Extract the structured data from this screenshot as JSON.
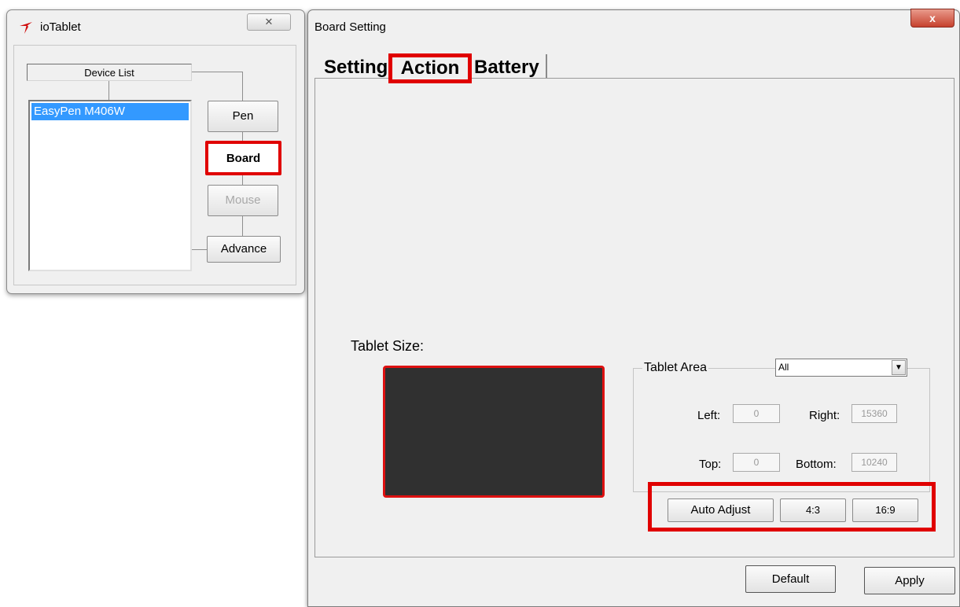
{
  "io_window": {
    "title": "ioTablet",
    "close_glyph": "✕",
    "device_list_label": "Device List",
    "devices": [
      "EasyPen M406W"
    ],
    "buttons": {
      "pen": "Pen",
      "board": "Board",
      "mouse": "Mouse",
      "advance": "Advance"
    }
  },
  "board_window": {
    "title": "Board Setting",
    "close_glyph": "x",
    "tabs": [
      "Setting",
      "Action",
      "Battery"
    ],
    "selected_tab": "Action",
    "tablet_size_label": "Tablet Size:",
    "tablet_area": {
      "label": "Tablet Area",
      "selected": "All",
      "left_label": "Left:",
      "left_value": "0",
      "right_label": "Right:",
      "right_value": "15360",
      "top_label": "Top:",
      "top_value": "0",
      "bottom_label": "Bottom:",
      "bottom_value": "10240"
    },
    "buttons": {
      "auto_adjust": "Auto Adjust",
      "ratio_4_3": "4:3",
      "ratio_16_9": "16:9",
      "default": "Default",
      "apply": "Apply"
    }
  },
  "colors": {
    "highlight": "#e00000",
    "selection": "#3399ff",
    "preview_fill": "#303030"
  }
}
